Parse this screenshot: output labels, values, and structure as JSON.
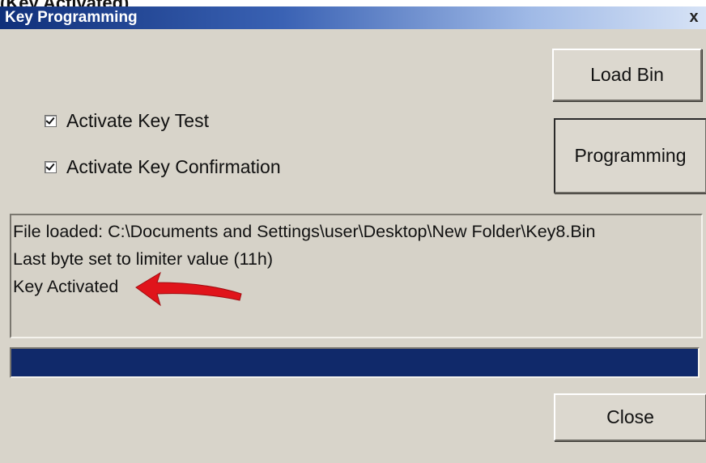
{
  "window": {
    "title": "Key Programming",
    "close_glyph": "x"
  },
  "top_partial_text": "(Key Activated)",
  "buttons": {
    "load_bin": "Load Bin",
    "programming": "Programming",
    "close": "Close"
  },
  "checkboxes": [
    {
      "label": "Activate Key Test",
      "checked": true
    },
    {
      "label": "Activate Key Confirmation",
      "checked": true
    }
  ],
  "log": {
    "lines": [
      "File loaded: C:\\Documents and Settings\\user\\Desktop\\New Folder\\Key8.Bin",
      "Last byte set to limiter value (11h)",
      "Key Activated"
    ]
  },
  "progress": {
    "fraction": 1.0
  },
  "annotation": {
    "icon": "red-arrow-icon",
    "color": "#e0141b"
  },
  "colors": {
    "titlebar_start": "#10307a",
    "progress_fill": "#10296a",
    "window_bg": "#d8d4ca"
  }
}
